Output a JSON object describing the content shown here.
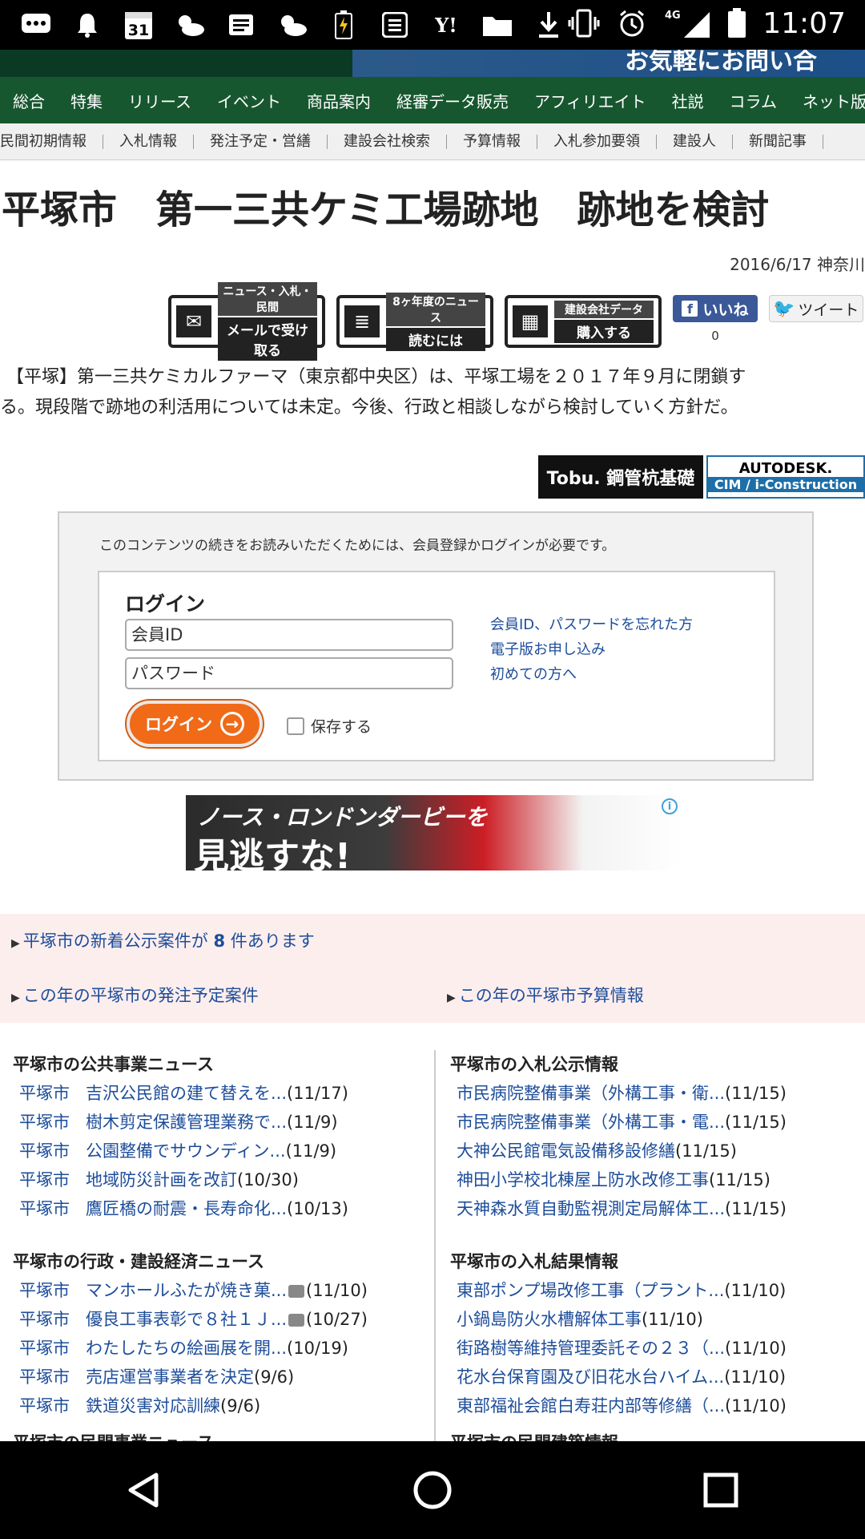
{
  "status_bar": {
    "time": "11:07",
    "network": "4G",
    "calendar_day": "31"
  },
  "banner_ad": {
    "text": "お気軽にお問い合"
  },
  "nav": {
    "items": [
      "総合",
      "特集",
      "リリース",
      "イベント",
      "商品案内",
      "経審データ販売",
      "アフィリエイト",
      "社説",
      "コラム",
      "ネット版"
    ]
  },
  "subnav": {
    "items": [
      "民間初期情報",
      "入札情報",
      "発注予定・営繕",
      "建設会社検索",
      "予算情報",
      "入札参加要領",
      "建設人",
      "新聞記事"
    ]
  },
  "article": {
    "title": "平塚市　第一三共ケミ工場跡地　跡地を検討",
    "dateline": "2016/6/17 神奈川",
    "body_line1": "【平塚】第一三共ケミカルファーマ（東京都中央区）は、平塚工場を２０１７年９月に閉鎖す",
    "body_line2": "る。現段階で跡地の利活用については未定。今後、行政と相談しながら検討していく方針だ。"
  },
  "share": {
    "mail": {
      "l1": "ニュース・入札・民間",
      "l2": "メールで受け取る"
    },
    "news": {
      "l1": "8ヶ年度のニュース",
      "l2": "読むには"
    },
    "company": {
      "l1": "建設会社データ",
      "l2": "購入する"
    },
    "fb_label": "いいね",
    "fb_count": "0",
    "tweet_label": "ツイート"
  },
  "ads": {
    "logo1": "Tobu. 鋼管杭基礎",
    "logo2_top": "AUTODESK.",
    "logo2_bottom": "CIM / i-Construction",
    "banner_line1": "ノース・ロンドンダービーを",
    "banner_line2": "見逃すな!"
  },
  "login": {
    "message": "このコンテンツの続きをお読みいただくためには、会員登録かログインが必要です。",
    "heading": "ログイン",
    "id_placeholder": "会員ID",
    "password_placeholder": "パスワード",
    "button": "ログイン",
    "remember": "保存する",
    "links": [
      "会員ID、パスワードを忘れた方",
      "電子版お申し込み",
      "初めての方へ"
    ]
  },
  "pink": {
    "new_notices_pre": "平塚市の新着公示案件が",
    "new_notices_count": "8",
    "new_notices_post": "件あります",
    "order_plan": "この年の平塚市の発注予定案件",
    "budget": "この年の平塚市予算情報"
  },
  "lists": {
    "public_news": {
      "heading": "平塚市の公共事業ニュース",
      "items": [
        {
          "city": "平塚市",
          "title": "吉沢公民館の建て替えを...",
          "date": "(11/17)"
        },
        {
          "city": "平塚市",
          "title": "樹木剪定保護管理業務で...",
          "date": "(11/9)"
        },
        {
          "city": "平塚市",
          "title": "公園整備でサウンディン...",
          "date": "(11/9)"
        },
        {
          "city": "平塚市",
          "title": "地域防災計画を改訂",
          "date": "(10/30)"
        },
        {
          "city": "平塚市",
          "title": "鷹匠橋の耐震・長寿命化...",
          "date": "(10/13)"
        }
      ]
    },
    "admin_news": {
      "heading": "平塚市の行政・建設経済ニュース",
      "items": [
        {
          "city": "平塚市",
          "title": "マンホールふたが焼き菓...",
          "date": "(11/10)",
          "cam": true
        },
        {
          "city": "平塚市",
          "title": "優良工事表彰で８社１Ｊ...",
          "date": "(10/27)",
          "cam": true
        },
        {
          "city": "平塚市",
          "title": "わたしたちの絵画展を開...",
          "date": "(10/19)"
        },
        {
          "city": "平塚市",
          "title": "売店運営事業者を決定",
          "date": "(9/6)"
        },
        {
          "city": "平塚市",
          "title": "鉄道災害対応訓練",
          "date": "(9/6)"
        }
      ]
    },
    "bid_notices": {
      "heading": "平塚市の入札公示情報",
      "items": [
        {
          "title": "市民病院整備事業（外構工事・衛...",
          "date": "(11/15)"
        },
        {
          "title": "市民病院整備事業（外構工事・電...",
          "date": "(11/15)"
        },
        {
          "title": "大神公民館電気設備移設修繕",
          "date": "(11/15)"
        },
        {
          "title": "神田小学校北棟屋上防水改修工事",
          "date": "(11/15)"
        },
        {
          "title": "天神森水質自動監視測定局解体工...",
          "date": "(11/15)"
        }
      ]
    },
    "bid_results": {
      "heading": "平塚市の入札結果情報",
      "items": [
        {
          "title": "東部ポンプ場改修工事（プラント...",
          "date": "(11/10)"
        },
        {
          "title": "小鍋島防火水槽解体工事",
          "date": "(11/10)"
        },
        {
          "title": "街路樹等維持管理委託その２３（...",
          "date": "(11/10)"
        },
        {
          "title": "花水台保育園及び旧花水台ハイム...",
          "date": "(11/10)"
        },
        {
          "title": "東部福祉会館白寿荘内部等修繕（...",
          "date": "(11/10)"
        }
      ]
    },
    "cut_left": "平塚市の民間事業ニュース",
    "cut_right": "平塚市の民間建築情報"
  }
}
